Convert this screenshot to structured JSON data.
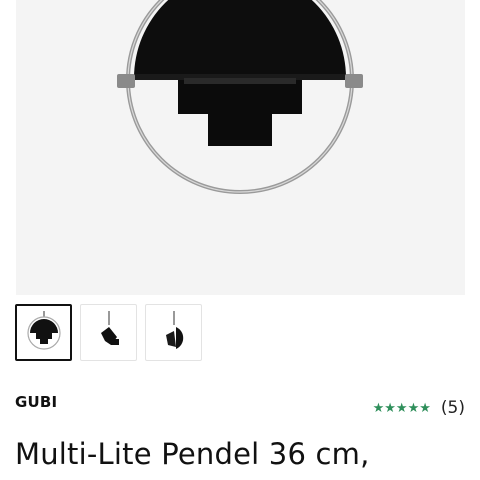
{
  "product": {
    "brand": "GUBI",
    "title": "Multi-Lite Pendel 36 cm,",
    "rating": {
      "stars": "★★★★★",
      "count": "(5)",
      "star_color": "#2f8f5b"
    }
  },
  "gallery": {
    "main_image": "pendant-lamp-black-chrome",
    "thumbnails": [
      {
        "icon": "pendant-front-view",
        "selected": true
      },
      {
        "icon": "pendant-side-view",
        "selected": false
      },
      {
        "icon": "pendant-angled-view",
        "selected": false
      }
    ]
  }
}
